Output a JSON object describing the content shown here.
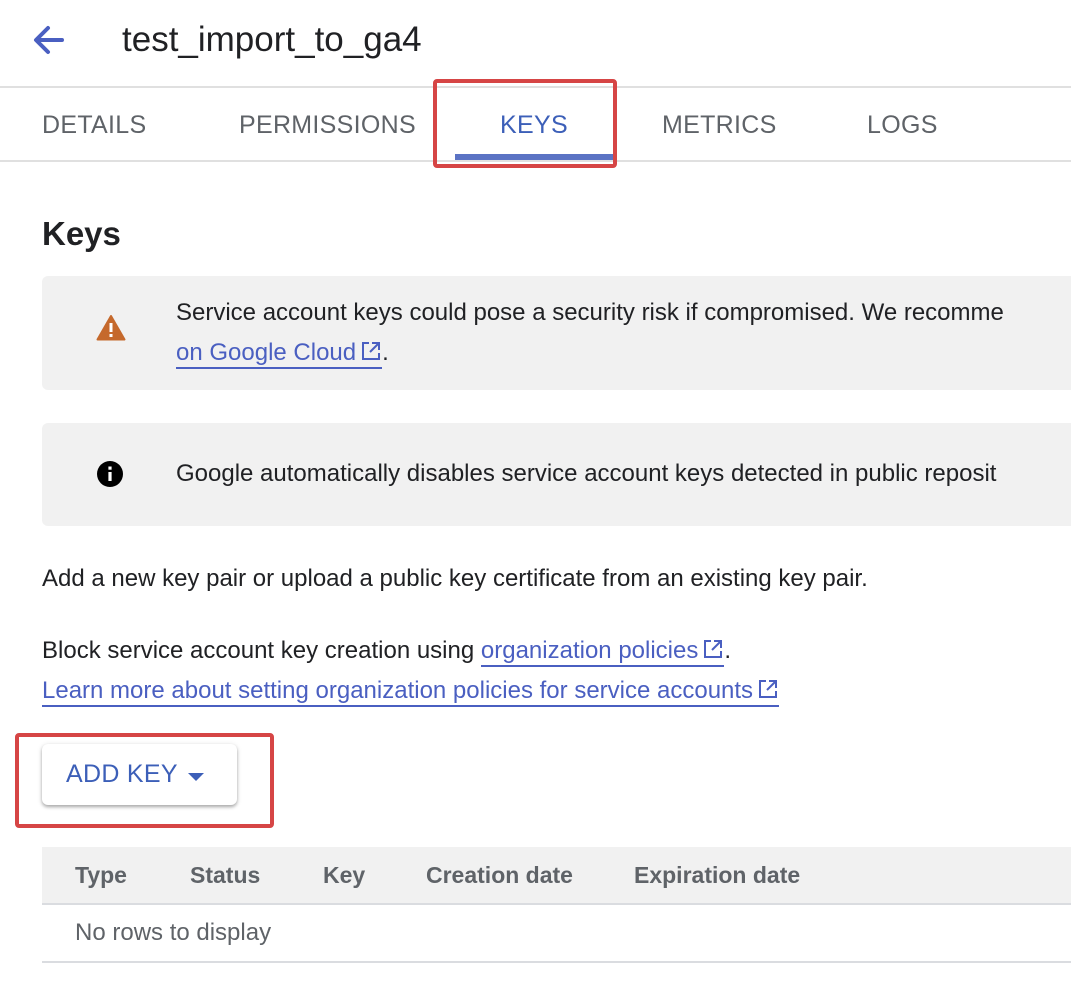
{
  "header": {
    "back_icon": "arrow-left-icon",
    "title": "test_import_to_ga4"
  },
  "tabs": [
    {
      "label": "DETAILS"
    },
    {
      "label": "PERMISSIONS"
    },
    {
      "label": "KEYS",
      "active": true
    },
    {
      "label": "METRICS"
    },
    {
      "label": "LOGS"
    }
  ],
  "keys_section": {
    "title": "Keys",
    "warning_banner": {
      "icon": "warning-icon",
      "text": "Service account keys could pose a security risk if compromised. We recomme",
      "link_text": "on Google Cloud",
      "link_suffix": "."
    },
    "info_banner": {
      "icon": "info-icon",
      "text": "Google automatically disables service account keys detected in public reposit"
    },
    "add_pair_text": "Add a new key pair or upload a public key certificate from an existing key pair.",
    "block_text": "Block service account key creation using ",
    "org_policies_link": "organization policies",
    "block_suffix": ".",
    "learn_more_link": "Learn more about setting organization policies for service accounts",
    "add_key_button": {
      "label": "ADD KEY",
      "icon": "caret-down-icon"
    }
  },
  "table": {
    "columns": [
      "Type",
      "Status",
      "Key",
      "Creation date",
      "Expiration date"
    ],
    "empty_message": "No rows to display"
  },
  "colors": {
    "accent": "#3c5fb8",
    "link": "#4a5fc1",
    "highlight_box": "#d64545",
    "warning": "#c5692c",
    "banner_bg": "#f1f1f1"
  }
}
